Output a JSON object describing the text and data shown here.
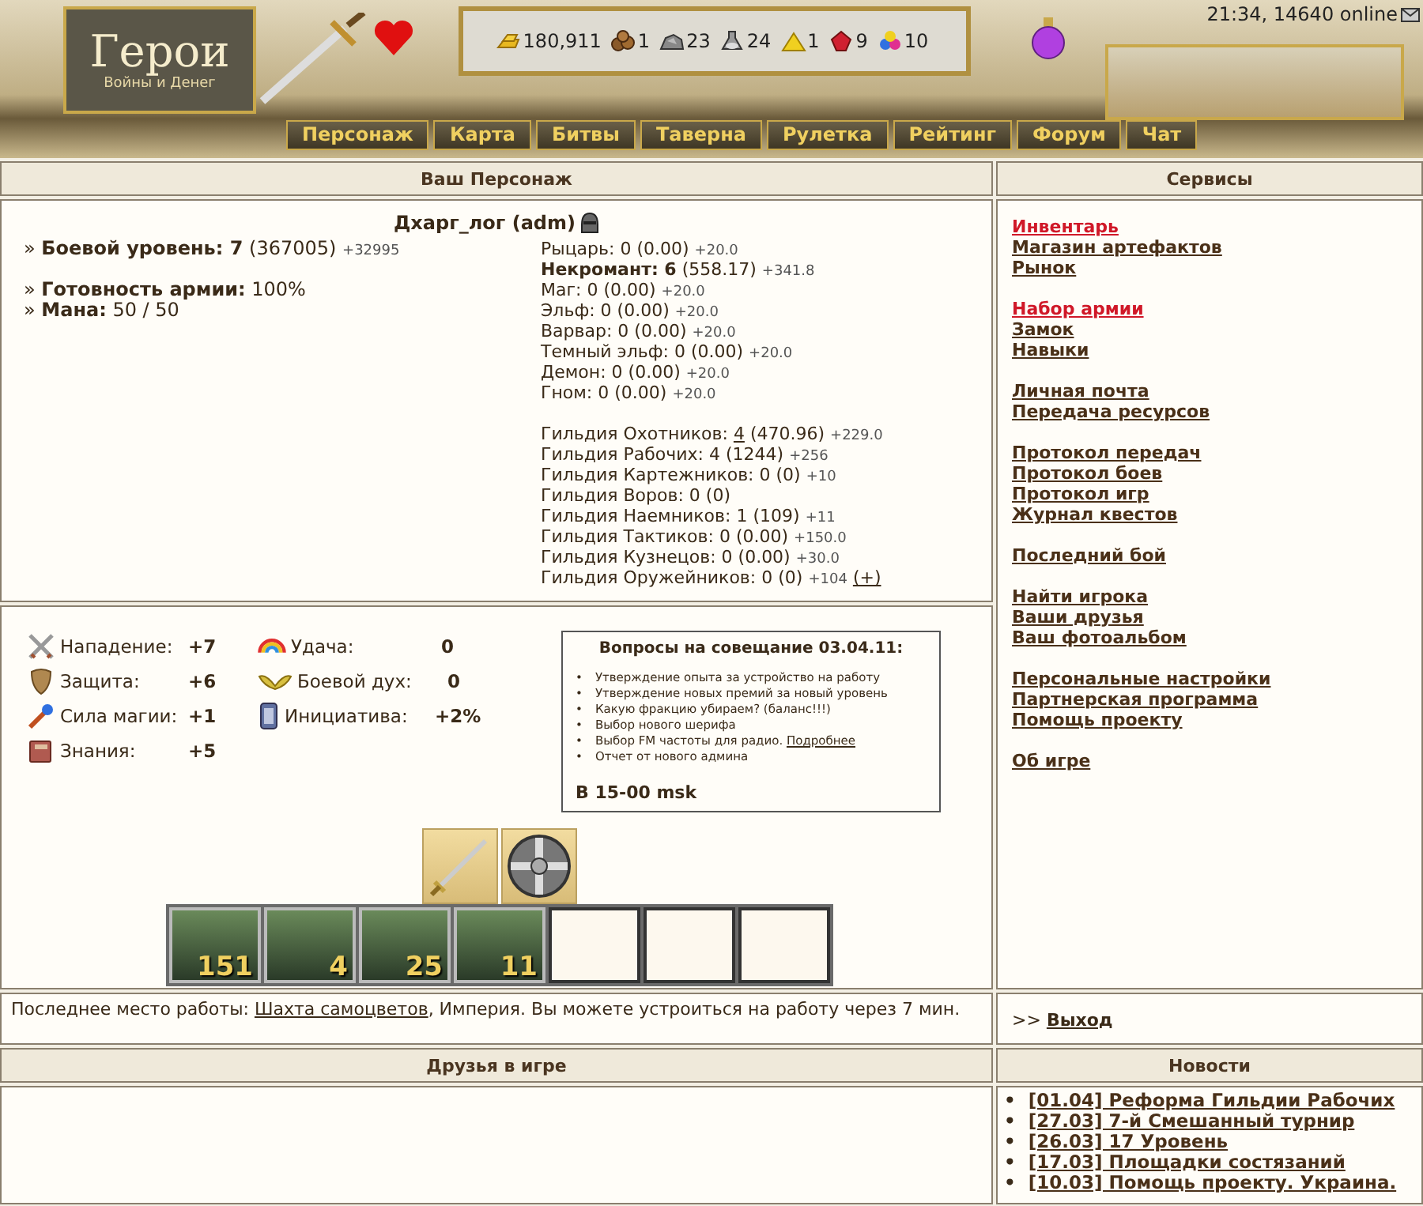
{
  "header": {
    "logo_title": "Герои",
    "logo_subtitle": "Войны и Денег",
    "status": "21:34, 14640 online",
    "resources": [
      {
        "kind": "gold",
        "value": "180,911"
      },
      {
        "kind": "wood",
        "value": "1"
      },
      {
        "kind": "ore",
        "value": "23"
      },
      {
        "kind": "mercury",
        "value": "24"
      },
      {
        "kind": "sulfur",
        "value": "1"
      },
      {
        "kind": "crystal",
        "value": "9"
      },
      {
        "kind": "gems",
        "value": "10"
      }
    ]
  },
  "nav": [
    {
      "label": "Персонаж"
    },
    {
      "label": "Карта"
    },
    {
      "label": "Битвы"
    },
    {
      "label": "Таверна"
    },
    {
      "label": "Рулетка"
    },
    {
      "label": "Рейтинг"
    },
    {
      "label": "Форум"
    },
    {
      "label": "Чат"
    }
  ],
  "character": {
    "title": "Ваш Персонаж",
    "name": "Дхарг_лог (adm)",
    "summary": [
      {
        "text": "» **Боевой уровень: 7** (367005)",
        "bonus": "+32995"
      },
      {
        "text": "» **Готовность армии:** 100%"
      },
      {
        "text": "» **Мана:** 50 / 50"
      }
    ],
    "factions": [
      {
        "text": "Рыцарь: 0 (0.00)",
        "bonus": "+20.0"
      },
      {
        "text": "**Некромант: 6** (558.17)",
        "bonus": "+341.8"
      },
      {
        "text": "Маг: 0 (0.00)",
        "bonus": "+20.0"
      },
      {
        "text": "Эльф: 0 (0.00)",
        "bonus": "+20.0"
      },
      {
        "text": "Варвар: 0 (0.00)",
        "bonus": "+20.0"
      },
      {
        "text": "Темный эльф: 0 (0.00)",
        "bonus": "+20.0"
      },
      {
        "text": "Демон: 0 (0.00)",
        "bonus": "+20.0"
      },
      {
        "text": "Гном: 0 (0.00)",
        "bonus": "+20.0"
      }
    ],
    "guilds": [
      {
        "label": "Гильдия Охотников:",
        "link": "4",
        "value": "(470.96)",
        "bonus": "+229.0"
      },
      {
        "label": "Гильдия Рабочих:",
        "value": "4 (1244)",
        "bonus": "+256"
      },
      {
        "label": "Гильдия Картежников:",
        "value": "0 (0)",
        "bonus": "+10"
      },
      {
        "label": "Гильдия Воров:",
        "value": "0 (0)"
      },
      {
        "label": "Гильдия Наемников:",
        "value": "1 (109)",
        "bonus": "+11"
      },
      {
        "label": "Гильдия Тактиков:",
        "value": "0 (0.00)",
        "bonus": "+150.0"
      },
      {
        "label": "Гильдия Кузнецов:",
        "value": "0 (0.00)",
        "bonus": "+30.0"
      },
      {
        "label": "Гильдия Оружейников:",
        "value": "0 (0)",
        "bonus": "+104",
        "action": "(+)"
      }
    ]
  },
  "stats": {
    "left": [
      {
        "kind": "attack",
        "label": "Нападение:",
        "value": "+7"
      },
      {
        "kind": "defense",
        "label": "Защита:",
        "value": "+6"
      },
      {
        "kind": "magic",
        "label": "Сила магии:",
        "value": "+1"
      },
      {
        "kind": "knowledge",
        "label": "Знания:",
        "value": "+5"
      }
    ],
    "right": [
      {
        "kind": "luck",
        "label": "Удача:",
        "value": "0"
      },
      {
        "kind": "morale",
        "label": "Боевой дух:",
        "value": "0"
      },
      {
        "kind": "initiative",
        "label": "Инициатива:",
        "value": "+2%"
      }
    ]
  },
  "notice": {
    "title": "Вопросы на совещание 03.04.11:",
    "items": [
      {
        "text": "Утверждение опыта за устройство на работу"
      },
      {
        "text": "Утверждение новых премий за новый уровень"
      },
      {
        "text": "Какую фракцию убираем? (баланс!!!)"
      },
      {
        "text": "Выбор нового шерифа"
      },
      {
        "text": "Выбор FM частоты для радио.",
        "link": "Подробнее"
      },
      {
        "text": "Отчет от нового админа"
      }
    ],
    "footer": "В 15-00 msk",
    "marker": "•"
  },
  "equipment": [
    {
      "kind": "sword"
    },
    {
      "kind": "shield"
    }
  ],
  "army": [
    {
      "kind": "unit",
      "count": "151"
    },
    {
      "kind": "unit",
      "count": "4"
    },
    {
      "kind": "unit",
      "count": "25"
    },
    {
      "kind": "unit",
      "count": "11"
    },
    {
      "kind": "empty"
    },
    {
      "kind": "empty"
    },
    {
      "kind": "empty"
    }
  ],
  "services": {
    "title": "Сервисы",
    "groups": [
      [
        {
          "label": "Инвентарь",
          "highlighted": true
        },
        {
          "label": "Магазин артефактов",
          "highlighted": false
        },
        {
          "label": "Рынок",
          "highlighted": false
        }
      ],
      [
        {
          "label": "Набор армии",
          "highlighted": true
        },
        {
          "label": "Замок",
          "highlighted": false
        },
        {
          "label": "Навыки",
          "highlighted": false
        }
      ],
      [
        {
          "label": "Личная почта",
          "highlighted": false
        },
        {
          "label": "Передача ресурсов",
          "highlighted": false
        }
      ],
      [
        {
          "label": "Протокол передач",
          "highlighted": false
        },
        {
          "label": "Протокол боев",
          "highlighted": false
        },
        {
          "label": "Протокол игр",
          "highlighted": false
        },
        {
          "label": "Журнал квестов",
          "highlighted": false
        }
      ],
      [
        {
          "label": "Последний бой",
          "highlighted": false
        }
      ],
      [
        {
          "label": "Найти игрока",
          "highlighted": false
        },
        {
          "label": "Ваши друзья",
          "highlighted": false
        },
        {
          "label": "Ваш фотоальбом",
          "highlighted": false
        }
      ],
      [
        {
          "label": "Персональные настройки",
          "highlighted": false
        },
        {
          "label": "Партнерская программа",
          "highlighted": false
        },
        {
          "label": "Помощь проекту",
          "highlighted": false
        }
      ],
      [
        {
          "label": "Об игре",
          "highlighted": false
        }
      ]
    ]
  },
  "work": {
    "before": "Последнее место работы:",
    "link": "Шахта самоцветов",
    "after": ", Империя. Вы можете устроиться на работу через 7 мин."
  },
  "logout": {
    "prefix": ">>",
    "link": "Выход"
  },
  "friends": {
    "title": "Друзья в игре"
  },
  "news": {
    "title": "Новости",
    "marker": "•",
    "items": [
      "[01.04] Реформа Гильдии Рабочих",
      "[27.03] 7-й Смешанный турнир",
      "[26.03] 17 Уровень",
      "[17.03] Площадки состязаний",
      "[10.03] Помощь проекту. Украина."
    ]
  }
}
